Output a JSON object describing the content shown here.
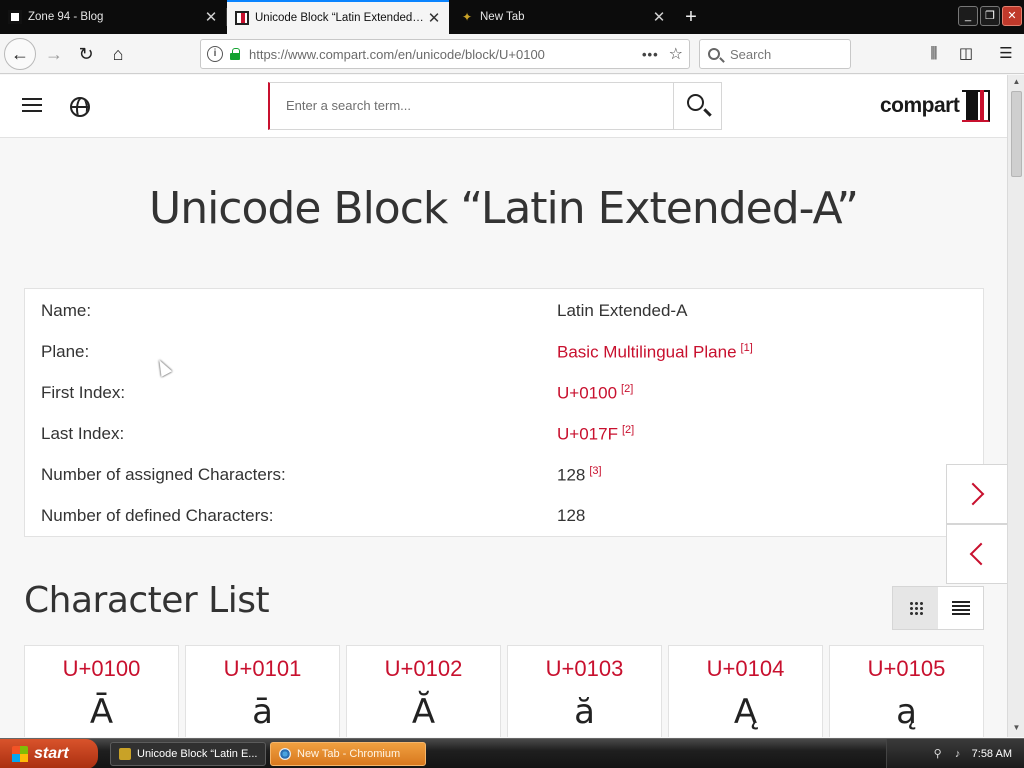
{
  "browser": {
    "tabs": [
      {
        "title": "Zone 94 - Blog",
        "icon": "zone94-favicon",
        "active": false
      },
      {
        "title": "Unicode Block “Latin Extended-A”",
        "icon": "compart-favicon",
        "active": true
      },
      {
        "title": "New Tab",
        "icon": "firefox-favicon",
        "active": false
      }
    ],
    "url": "https://www.compart.com/en/unicode/block/U+0100",
    "search_placeholder": "Search",
    "window_buttons": {
      "minimize": "_",
      "restore": "❐",
      "close": "✕"
    }
  },
  "site": {
    "search_placeholder": "Enter a search term...",
    "logo_text": "compart",
    "page_title": "Unicode Block “Latin Extended-A”",
    "info": [
      {
        "label": "Name:",
        "value": "Latin Extended-A",
        "link": false,
        "ref": ""
      },
      {
        "label": "Plane:",
        "value": "Basic Multilingual Plane",
        "link": true,
        "ref": "[1]"
      },
      {
        "label": "First Index:",
        "value": "U+0100",
        "link": true,
        "ref": "[2]"
      },
      {
        "label": "Last Index:",
        "value": "U+017F",
        "link": true,
        "ref": "[2]"
      },
      {
        "label": "Number of assigned Characters:",
        "value": "128",
        "link": false,
        "ref": "[3]"
      },
      {
        "label": "Number of defined Characters:",
        "value": "128",
        "link": false,
        "ref": ""
      }
    ],
    "section_title": "Character List",
    "characters": [
      {
        "code": "U+0100",
        "glyph": "Ā"
      },
      {
        "code": "U+0101",
        "glyph": "ā"
      },
      {
        "code": "U+0102",
        "glyph": "Ă"
      },
      {
        "code": "U+0103",
        "glyph": "ă"
      },
      {
        "code": "U+0104",
        "glyph": "Ą"
      },
      {
        "code": "U+0105",
        "glyph": "ą"
      }
    ]
  },
  "taskbar": {
    "start_label": "start",
    "items": [
      {
        "title": "Unicode Block “Latin E...",
        "icon": "firefox-icon"
      },
      {
        "title": "New Tab - Chromium",
        "icon": "chromium-icon"
      }
    ],
    "clock": "7:58 AM"
  },
  "colors": {
    "accent": "#c8102e",
    "tab_active_indicator": "#0a84ff",
    "start_button": "#c13b18"
  }
}
